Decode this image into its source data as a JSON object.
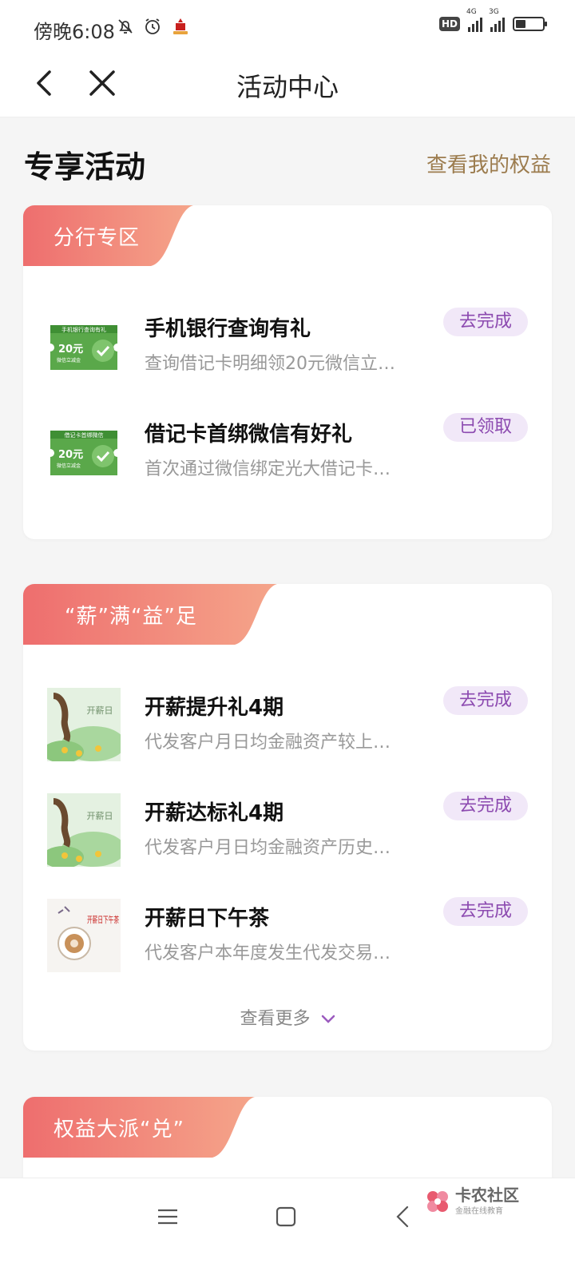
{
  "status_bar": {
    "time": "傍晚6:08",
    "hd": "HD",
    "sig1_label": "4G",
    "sig2_label": "3G"
  },
  "nav": {
    "title": "活动中心"
  },
  "section": {
    "title": "专享活动",
    "link": "查看我的权益"
  },
  "cards": [
    {
      "tag": "分行专区",
      "items": [
        {
          "title": "手机银行查询有礼",
          "desc": "查询借记卡明细领20元微信立…",
          "button": "去完成",
          "thumb_top": "手机银行查询有礼",
          "thumb_amount": "20元",
          "thumb_sub": "微信立减金"
        },
        {
          "title": "借记卡首绑微信有好礼",
          "desc": "首次通过微信绑定光大借记卡…",
          "button": "已领取",
          "thumb_top": "借记卡首绑微信",
          "thumb_amount": "20元",
          "thumb_sub": "微信立减金"
        }
      ]
    },
    {
      "tag": "“薪”满“益”足",
      "items": [
        {
          "title": "开薪提升礼4期",
          "desc": "代发客户月日均金融资产较上…",
          "button": "去完成",
          "thumb_text": "开薪日"
        },
        {
          "title": "开薪达标礼4期",
          "desc": "代发客户月日均金融资产历史…",
          "button": "去完成",
          "thumb_text": "开薪日"
        },
        {
          "title": "开薪日下午茶",
          "desc": "代发客户本年度发生代发交易…",
          "button": "去完成",
          "thumb_text": "开薪日下午茶"
        }
      ],
      "more": "查看更多"
    },
    {
      "tag": "权益大派“兑”"
    }
  ],
  "watermark": {
    "title": "卡农社区",
    "sub": "金融在线教育"
  },
  "colors": {
    "tag_gradient_start": "#ee6e6e",
    "tag_gradient_end": "#f5a58a",
    "button_bg": "#f1e8f8",
    "button_text": "#8c4ab0",
    "link": "#9c7c4e"
  }
}
